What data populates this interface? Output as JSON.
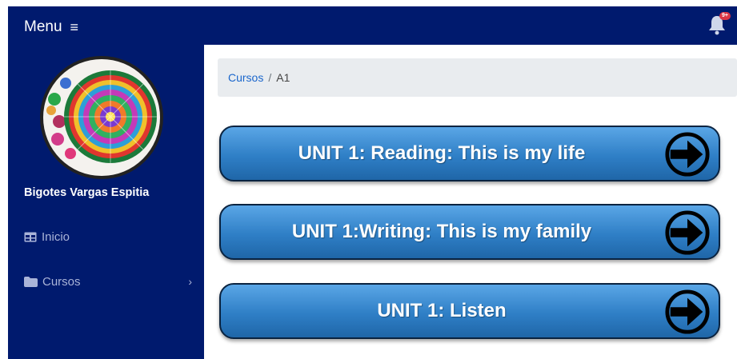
{
  "header": {
    "menu_label": "Menu",
    "menu_icon": "hamburger-icon",
    "notification_icon": "bell-icon",
    "notification_count": "9+",
    "notification_color": "#dc3545"
  },
  "sidebar": {
    "user_name": "Bigotes Vargas Espitia",
    "items": [
      {
        "label": "Inicio",
        "icon": "table-icon"
      },
      {
        "label": "Cursos",
        "icon": "folder-icon",
        "expand_icon": "chevron-right-icon"
      }
    ]
  },
  "breadcrumb": {
    "link": "Cursos",
    "separator": "/",
    "current": "A1"
  },
  "units": [
    {
      "label": "UNIT 1: Reading: This is my life",
      "icon": "arrow-right-circle-icon"
    },
    {
      "label": "UNIT 1:Writing: This is my family",
      "icon": "arrow-right-circle-icon"
    },
    {
      "label": "UNIT 1: Listen",
      "icon": "arrow-right-circle-icon"
    }
  ],
  "colors": {
    "navy": "#001a6e",
    "link": "#1a66cc",
    "button_blue": "#2f7fc6",
    "breadcrumb_bg": "#e9ecef"
  }
}
